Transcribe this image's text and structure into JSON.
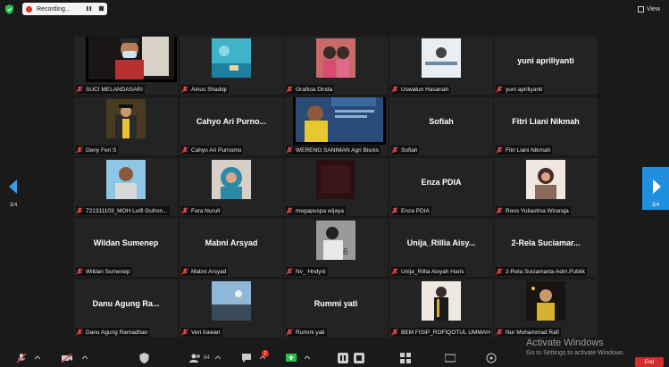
{
  "topbar": {
    "recording_label": "Recording...",
    "view_label": "View"
  },
  "participants": [
    {
      "name": "SUCI MELANDASARI",
      "display": "",
      "kind": "video-person"
    },
    {
      "name": "Ainus Shadiqi",
      "display": "",
      "kind": "photo-sea"
    },
    {
      "name": "Graficia Dinda",
      "display": "",
      "kind": "photo-girls"
    },
    {
      "name": "Uswatun Hasanah",
      "display": "",
      "kind": "photo-desk"
    },
    {
      "name": "yuni apriliyanti",
      "display": "yuni apriliyanti",
      "kind": "text"
    },
    {
      "name": "Deny Feri S",
      "display": "",
      "kind": "photo-grad"
    },
    {
      "name": "Cahyo Ari Purnomo",
      "display": "Cahyo  Ari  Purno...",
      "kind": "text"
    },
    {
      "name": "WERENG SANIMAN Agri Bisnis",
      "display": "",
      "kind": "video-screen"
    },
    {
      "name": "Sofiah",
      "display": "Sofiah",
      "kind": "text"
    },
    {
      "name": "Fitri Liani Nikmah",
      "display": "Fitri Liani Nikmah",
      "kind": "text"
    },
    {
      "name": "721311103_MOH Lutfi Gufron...",
      "display": "",
      "kind": "photo-man"
    },
    {
      "name": "Fara Nurull",
      "display": "",
      "kind": "photo-hijab"
    },
    {
      "name": "megapuspa wijaya",
      "display": "",
      "kind": "photo-dark"
    },
    {
      "name": "Enza PDIA",
      "display": "Enza PDIA",
      "kind": "text"
    },
    {
      "name": "Roos Yuliastina Wiraraja",
      "display": "",
      "kind": "photo-woman"
    },
    {
      "name": "Wildan Sumenep",
      "display": "Wildan Sumenep",
      "kind": "text"
    },
    {
      "name": "Mabni Arsyad",
      "display": "Mabni Arsyad",
      "kind": "text"
    },
    {
      "name": "Nv_ Hndyni",
      "display": "",
      "kind": "photo-bw"
    },
    {
      "name": "Unija_Rillia Aisyah Haris",
      "display": "Unija_Rillia  Aisy...",
      "kind": "text"
    },
    {
      "name": "2-Rela Suciamarta-Adm.Publik",
      "display": "2-Rela  Suciamar...",
      "kind": "text"
    },
    {
      "name": "Danu Agung Ramadhan",
      "display": "Danu Agung Ra...",
      "kind": "text"
    },
    {
      "name": "Veri Irawan",
      "display": "",
      "kind": "photo-sky"
    },
    {
      "name": "Rummi yati",
      "display": "Rummi yati",
      "kind": "text"
    },
    {
      "name": "BEM FISIP_ROFIQOTUL UMMAH",
      "display": "",
      "kind": "photo-gown"
    },
    {
      "name": "Nur Mohammad Rafi",
      "display": "",
      "kind": "photo-night"
    }
  ],
  "pagination": {
    "left_count": "3/4",
    "right_count": "3/4"
  },
  "toolbar": {
    "participants_count": "84",
    "chat_badge": "2",
    "end_label": "End"
  },
  "watermark": {
    "line1": "Activate Windows",
    "line2": "Go to Settings to activate Windows."
  },
  "colors": {
    "accent": "#1f8fe0",
    "end_red": "#d22c2c",
    "mic_muted": "#e04848",
    "record_dot": "#e02a2a"
  }
}
